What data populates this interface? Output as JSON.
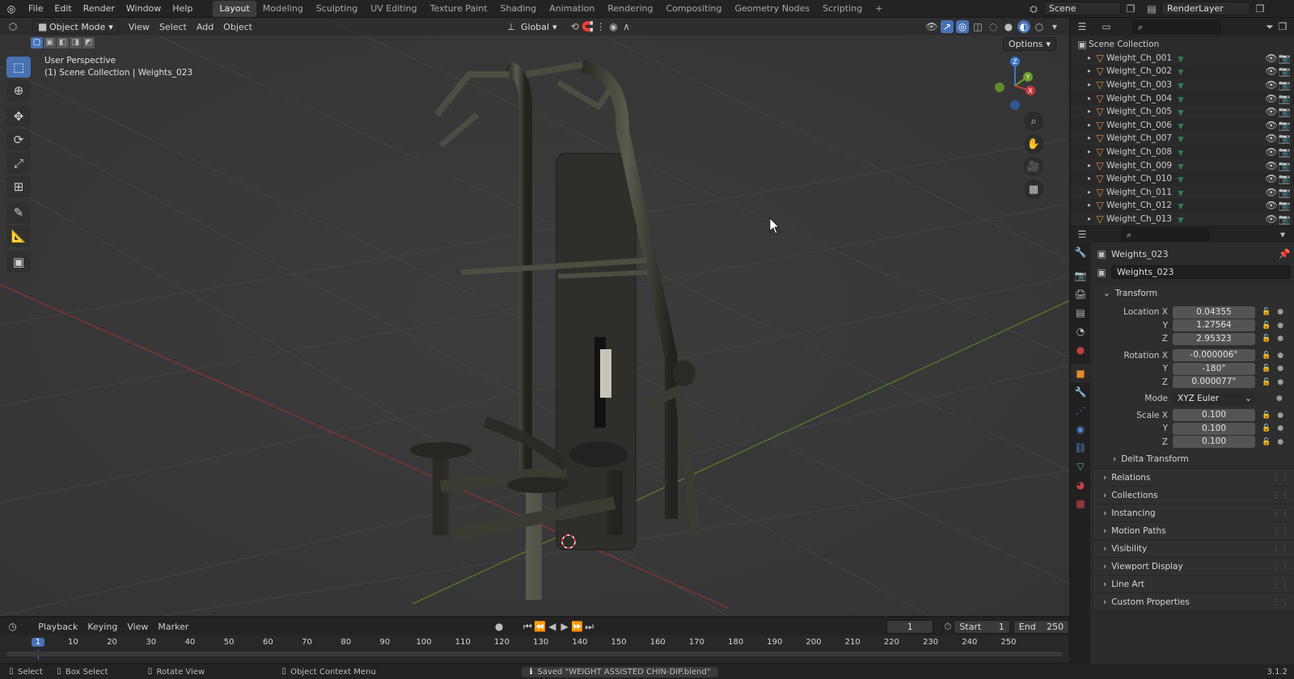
{
  "topbar": {
    "menus": [
      "File",
      "Edit",
      "Render",
      "Window",
      "Help"
    ],
    "workspaces": [
      "Layout",
      "Modeling",
      "Sculpting",
      "UV Editing",
      "Texture Paint",
      "Shading",
      "Animation",
      "Rendering",
      "Compositing",
      "Geometry Nodes",
      "Scripting"
    ],
    "active_workspace": "Layout",
    "add_tab": "+",
    "scene": "Scene",
    "view_layer": "RenderLayer"
  },
  "viewport_header": {
    "mode": "Object Mode",
    "menus": [
      "View",
      "Select",
      "Add",
      "Object"
    ],
    "orientation": "Global",
    "options": "Options"
  },
  "viewport": {
    "perspective": "User Perspective",
    "context": "(1) Scene Collection | Weights_023",
    "gizmo": {
      "z": "Z",
      "x": "X",
      "y": "Y"
    }
  },
  "outliner": {
    "root": "Scene Collection",
    "items": [
      "Weight_Ch_001",
      "Weight_Ch_002",
      "Weight_Ch_003",
      "Weight_Ch_004",
      "Weight_Ch_005",
      "Weight_Ch_006",
      "Weight_Ch_007",
      "Weight_Ch_008",
      "Weight_Ch_009",
      "Weight_Ch_010",
      "Weight_Ch_011",
      "Weight_Ch_012",
      "Weight_Ch_013"
    ]
  },
  "properties": {
    "object_name": "Weights_023",
    "data_name": "Weights_023",
    "transform_title": "Transform",
    "location_label": "Location X",
    "location": [
      "0.04355",
      "1.27564",
      "2.95323"
    ],
    "rotation_label": "Rotation X",
    "rotation": [
      "-0.000006°",
      "-180°",
      "0.000077°"
    ],
    "axis_labels": [
      "Y",
      "Z"
    ],
    "mode_label": "Mode",
    "mode_value": "XYZ Euler",
    "scale_label": "Scale X",
    "scale": [
      "0.100",
      "0.100",
      "0.100"
    ],
    "delta": "Delta Transform",
    "panels": [
      "Relations",
      "Collections",
      "Instancing",
      "Motion Paths",
      "Visibility",
      "Viewport Display",
      "Line Art",
      "Custom Properties"
    ]
  },
  "timeline": {
    "menus": [
      "Playback",
      "Keying",
      "View",
      "Marker"
    ],
    "current_frame": "1",
    "start_label": "Start",
    "start": "1",
    "end_label": "End",
    "end": "250",
    "ticks": [
      "1",
      "10",
      "20",
      "30",
      "40",
      "50",
      "60",
      "70",
      "80",
      "90",
      "100",
      "110",
      "120",
      "130",
      "140",
      "150",
      "160",
      "170",
      "180",
      "190",
      "200",
      "210",
      "220",
      "230",
      "240",
      "250"
    ]
  },
  "statusbar": {
    "select": "Select",
    "box_select": "Box Select",
    "rotate_view": "Rotate View",
    "context_menu": "Object Context Menu",
    "message": "Saved \"WEIGHT ASSISTED CHIN-DIP.blend\"",
    "version": "3.1.2"
  },
  "colors": {
    "accent": "#4772b3",
    "x_axis": "#c23b3b",
    "y_axis": "#6a9d2a",
    "z_axis": "#3c78c8"
  }
}
